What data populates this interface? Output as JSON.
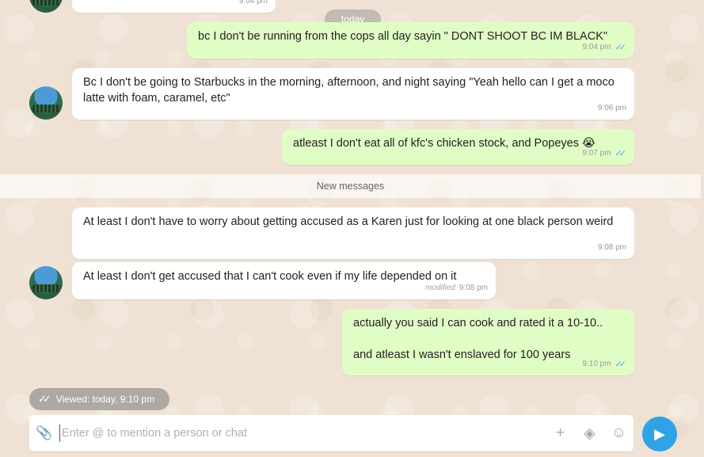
{
  "date_separator": "today",
  "messages": [
    {
      "time": "9:04 pm"
    },
    {
      "text": "bc I don't be running from the cops all day sayin \" DONT SHOOT BC IM BLACK\"",
      "time": "9:04 pm"
    },
    {
      "text": "Bc I don't be going to Starbucks in the morning, afternoon, and night saying \"Yeah hello can I get a moco latte with foam, caramel, etc\"",
      "time": "9:06 pm"
    },
    {
      "text": "atleast I don't eat all of kfc's chicken stock, and Popeyes 😭",
      "time": "9:07 pm"
    },
    {
      "text": "At least I don't have to worry about getting accused as a Karen just for looking at one black person weird",
      "time": "9:08 pm"
    },
    {
      "text": "At least I don't get accused that I can't cook even if my life depended on it",
      "modified": "modified",
      "time": "9:08 pm"
    },
    {
      "text": "actually you said I can cook and rated it a 10-10..\n\nand atleast I wasn't enslaved for 100 years",
      "time": "9:10 pm"
    }
  ],
  "new_messages_label": "New messages",
  "viewed_status": "Viewed: today, 9:10 pm",
  "composer": {
    "placeholder": "Enter @ to mention a person or chat",
    "icons": [
      "paperclip-icon",
      "plus-icon",
      "box-icon",
      "emoji-icon"
    ]
  },
  "send_icon": "send-arrow-icon",
  "colors": {
    "incoming_bubble": "#ffffff",
    "outgoing_bubble": "#e1fdc6",
    "read_tick": "#4fa6e6",
    "send_button": "#2fa3e6"
  }
}
